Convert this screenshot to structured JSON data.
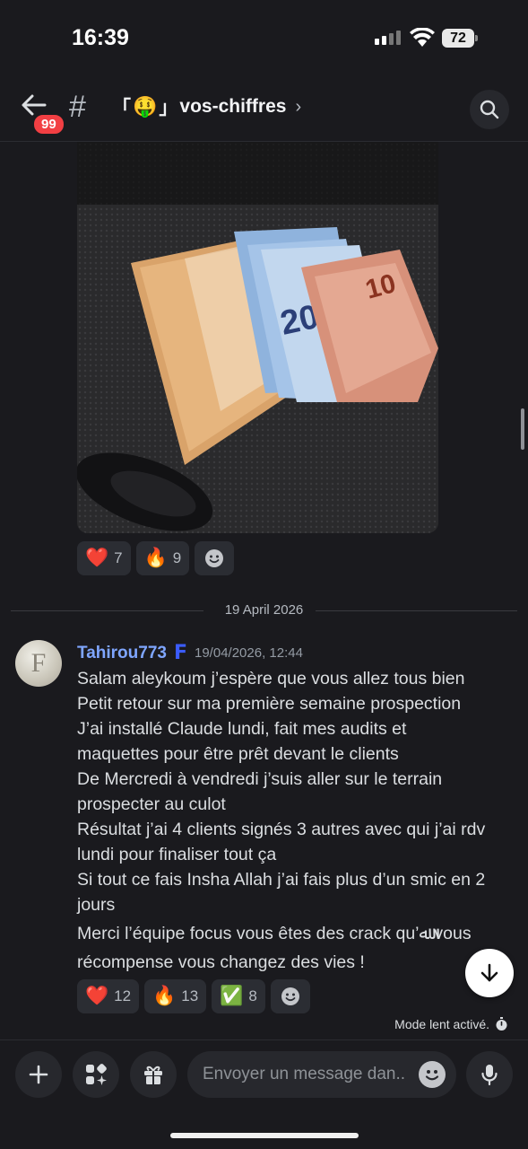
{
  "status": {
    "time": "16:39",
    "battery": "72"
  },
  "header": {
    "unread_badge": "99",
    "channel_prefix": "#",
    "channel_open": "「",
    "channel_emoji": "🤑",
    "channel_close": "」",
    "channel_name": "vos-chiffres",
    "chevron": "›"
  },
  "top_reactions": [
    {
      "emoji": "❤️",
      "count": "7"
    },
    {
      "emoji": "🔥",
      "count": "9"
    }
  ],
  "date_divider": "19 April 2026",
  "message": {
    "avatar_letter": "F",
    "username": "Tahirou773",
    "user_badge": "F",
    "timestamp": "19/04/2026, 12:44",
    "lines": [
      "Salam aleykoum j’espère que vous allez tous bien",
      "Petit retour sur ma première semaine prospection",
      "J’ai installé Claude lundi, fait mes audits et",
      "maquettes pour être prêt devant le clients",
      "De Mercredi à vendredi j’suis aller sur le terrain",
      "prospecter au culot",
      "Résultat j’ai 4 clients signés 3 autres avec qui j’ai rdv",
      "lundi pour finaliser tout ça",
      "Si tout ce fais Insha Allah j’ai fais plus d’un smic en 2",
      "jours",
      "Merci l’équipe focus vous êtes des crack qu’ﷲ vous",
      "récompense vous changez des vies !"
    ],
    "reactions": [
      {
        "emoji": "❤️",
        "count": "12"
      },
      {
        "emoji": "🔥",
        "count": "13"
      },
      {
        "emoji": "✅",
        "count": "8"
      }
    ]
  },
  "slowmode_label": "Mode lent activé.",
  "composer": {
    "placeholder": "Envoyer un message dan.."
  },
  "icons": [
    "back-arrow-icon",
    "hash-icon",
    "search-icon",
    "smile-add-icon",
    "arrow-down-icon",
    "stopwatch-icon",
    "plus-icon",
    "apps-icon",
    "gift-icon",
    "emoji-icon",
    "mic-icon"
  ]
}
